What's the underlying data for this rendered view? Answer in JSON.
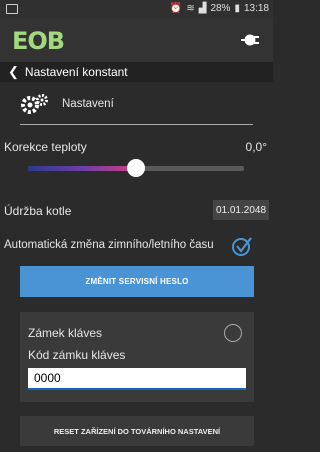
{
  "status": {
    "time": "13:18",
    "battery": "28%"
  },
  "app": {
    "logo": "EOB"
  },
  "breadcrumb": {
    "title": "Nastavení konstant"
  },
  "settings": {
    "title": "Nastavení"
  },
  "temp": {
    "label": "Korekce teploty",
    "value": "0,0°",
    "level": 0.5
  },
  "boiler": {
    "label": "Údržba kotle",
    "date": "01.01.2048"
  },
  "dst": {
    "label": "Automatická změna zimního/letního času",
    "checked": true
  },
  "buttons": {
    "change_password": "ZMĚNIT SERVISNÍ HESLO",
    "factory_reset": "RESET ZAŘÍZENÍ DO TOVÁRNÍHO NASTAVENÍ"
  },
  "keylock": {
    "label": "Zámek kláves",
    "code_label": "Kód zámku kláves",
    "code_value": "0000"
  },
  "colors": {
    "accent": "#4a94d6",
    "logo": "#a3d87f",
    "background": "#2b2b2b"
  }
}
